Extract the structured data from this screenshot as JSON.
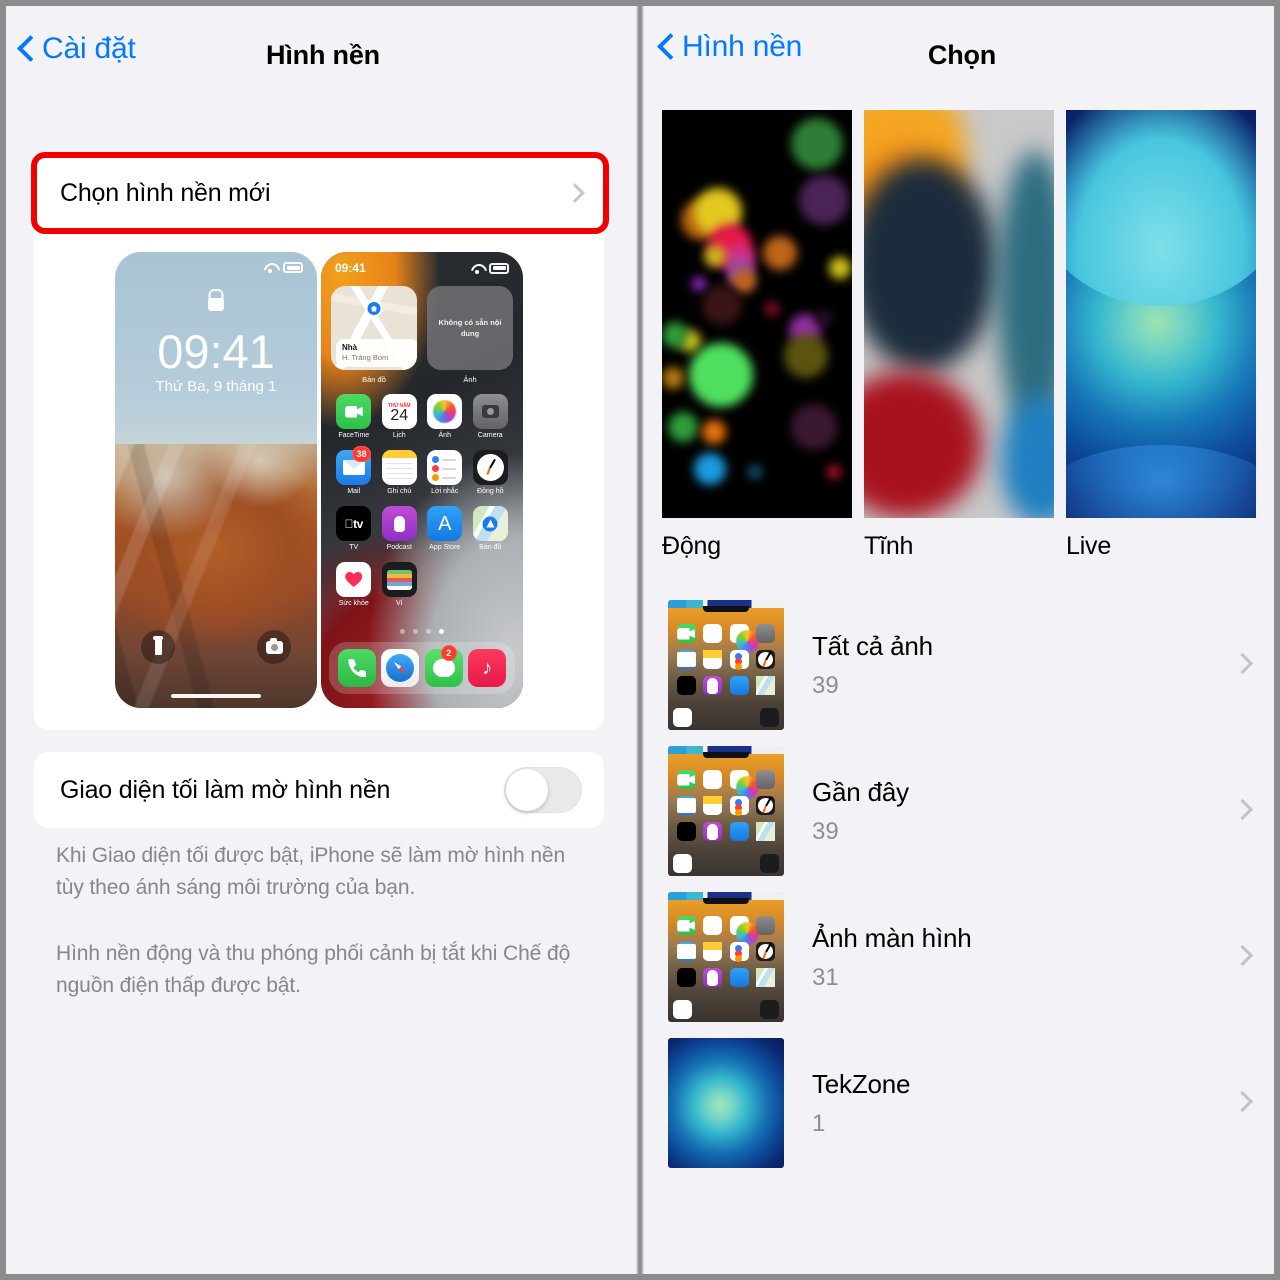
{
  "left_panel": {
    "nav": {
      "back_label": "Cài đặt",
      "back_icon": "chevron-left-icon",
      "title": "Hình nền"
    },
    "choose_row": {
      "label": "Chọn hình nền mới",
      "chevron_icon": "chevron-right-icon",
      "highlighted": true,
      "highlight_color": "#f20000"
    },
    "preview": {
      "lock_screen": {
        "time": "09:41",
        "date": "Thứ Ba, 9 tháng 1",
        "lock_icon": "lock-icon",
        "wifi_icon": "wifi-icon",
        "battery_icon": "battery-icon",
        "flashlight_icon": "flashlight-icon",
        "camera_icon": "camera-icon"
      },
      "home_screen": {
        "status_time": "09:41",
        "widgets": [
          {
            "name": "Nhà",
            "subtitle": "H. Trảng Bom",
            "label": "Bản đồ"
          },
          {
            "empty_text": "Không có sẵn nội dung",
            "label": "Ảnh"
          }
        ],
        "apps": [
          {
            "name": "FaceTime",
            "badge": ""
          },
          {
            "name": "Lịch",
            "badge": "",
            "cal_weekday": "THỨ NĂM",
            "cal_day": "24"
          },
          {
            "name": "Ảnh",
            "badge": ""
          },
          {
            "name": "Camera",
            "badge": ""
          },
          {
            "name": "Mail",
            "badge": "38"
          },
          {
            "name": "Ghi chú",
            "badge": ""
          },
          {
            "name": "Lời nhắc",
            "badge": ""
          },
          {
            "name": "Đồng hồ",
            "badge": ""
          },
          {
            "name": "TV",
            "badge": ""
          },
          {
            "name": "Podcast",
            "badge": ""
          },
          {
            "name": "App Store",
            "badge": ""
          },
          {
            "name": "Bản đồ",
            "badge": ""
          },
          {
            "name": "Sức khỏe",
            "badge": ""
          },
          {
            "name": "Ví",
            "badge": ""
          }
        ],
        "page_dots": 4,
        "active_dot": 4,
        "dock": [
          {
            "name": "Điện thoại",
            "badge": ""
          },
          {
            "name": "Safari",
            "badge": ""
          },
          {
            "name": "Tin nhắn",
            "badge": "2"
          },
          {
            "name": "Nhạc",
            "badge": ""
          }
        ]
      }
    },
    "toggle_row": {
      "label": "Giao diện tối làm mờ hình nền",
      "state": "off"
    },
    "footer": {
      "paragraph_1": "Khi Giao diện tối được bật, iPhone sẽ làm mờ hình nền tùy theo ánh sáng môi trường của bạn.",
      "paragraph_2": "Hình nền động và thu phóng phối cảnh bị tắt khi Chế độ nguồn điện thấp được bật."
    }
  },
  "right_panel": {
    "nav": {
      "back_label": "Hình nền",
      "back_icon": "chevron-left-icon",
      "title": "Chọn"
    },
    "categories": [
      {
        "label": "Động",
        "thumb": "dynamic-bokeh-thumbnail"
      },
      {
        "label": "Tĩnh",
        "thumb": "still-abstract-thumbnail"
      },
      {
        "label": "Live",
        "thumb": "live-circles-thumbnail"
      }
    ],
    "albums": [
      {
        "title": "Tất cả ảnh",
        "count": "39",
        "thumb": "home-screen-thumbnail",
        "chevron_icon": "chevron-right-icon"
      },
      {
        "title": "Gần đây",
        "count": "39",
        "thumb": "home-screen-thumbnail",
        "chevron_icon": "chevron-right-icon"
      },
      {
        "title": "Ảnh màn hình",
        "count": "31",
        "thumb": "home-screen-thumbnail",
        "chevron_icon": "chevron-right-icon"
      },
      {
        "title": "TekZone",
        "count": "1",
        "thumb": "live-circles-thumbnail",
        "chevron_icon": "chevron-right-icon"
      }
    ]
  },
  "colors": {
    "accent": "#007aff",
    "annotation": "#f20000",
    "background": "#f2f2f7",
    "card": "#ffffff",
    "secondary_text": "#8e8e93"
  }
}
